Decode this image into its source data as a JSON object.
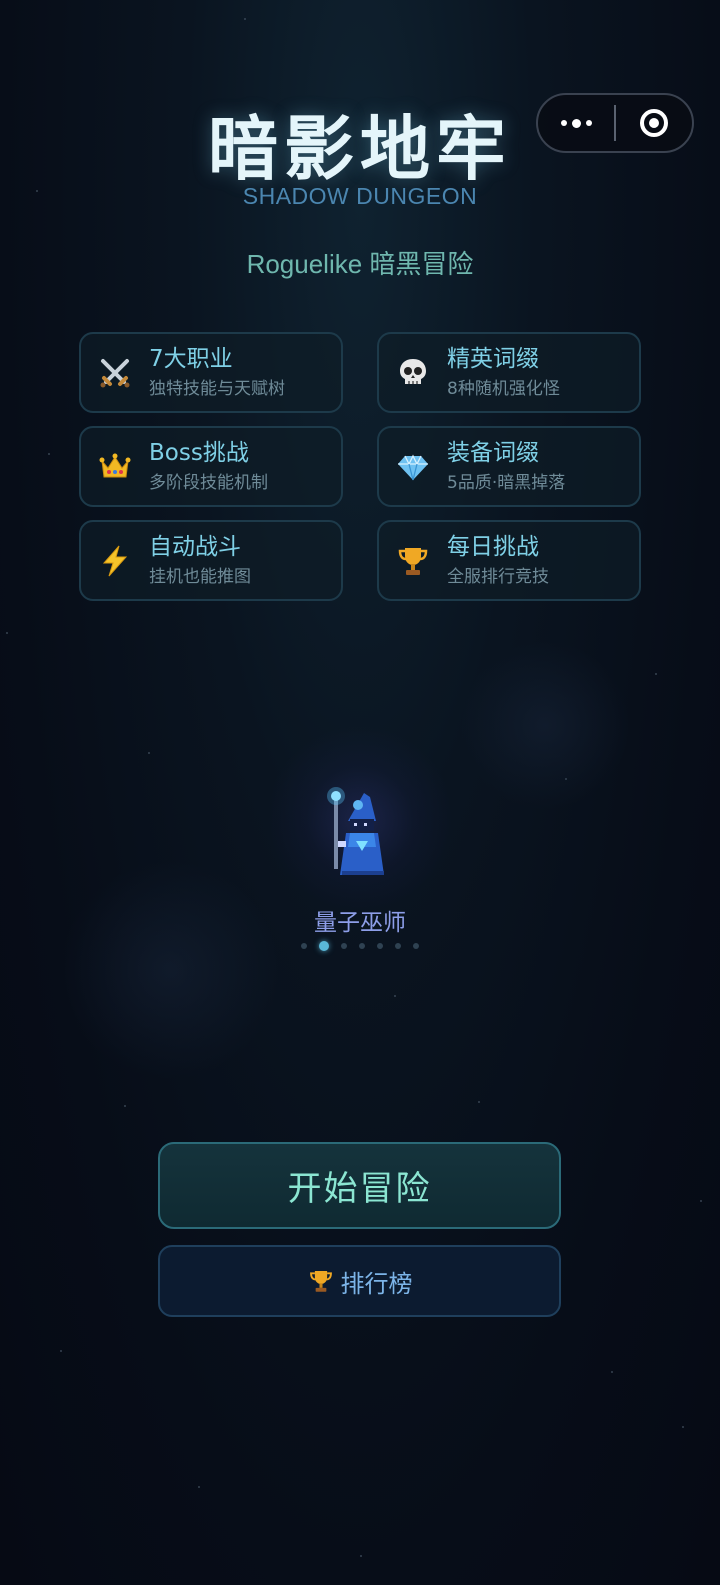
{
  "capsule": {
    "more_icon": "more-dots-icon",
    "close_icon": "target-close-icon"
  },
  "header": {
    "title": "暗影地牢",
    "subtitle_en": "SHADOW DUNGEON",
    "tagline": "Roguelike 暗黑冒险"
  },
  "features": [
    {
      "icon": "crossed-swords-icon",
      "name": "7大职业",
      "desc": "独特技能与天赋树"
    },
    {
      "icon": "skull-icon",
      "name": "精英词缀",
      "desc": "8种随机强化怪"
    },
    {
      "icon": "crown-icon",
      "name": "Boss挑战",
      "desc": "多阶段技能机制"
    },
    {
      "icon": "gem-icon",
      "name": "装备词缀",
      "desc": "5品质·暗黑掉落"
    },
    {
      "icon": "lightning-icon",
      "name": "自动战斗",
      "desc": "挂机也能推图"
    },
    {
      "icon": "trophy-icon",
      "name": "每日挑战",
      "desc": "全服排行竞技"
    }
  ],
  "character": {
    "name": "量子巫师",
    "sprite_icon": "wizard-sprite",
    "page_count": 7,
    "active_index": 1
  },
  "buttons": {
    "start_label": "开始冒险",
    "rank_label": "排行榜",
    "rank_icon": "trophy-icon"
  },
  "colors": {
    "title": "#e4f5fa",
    "feature_name": "#7fd0e6",
    "start_text": "#8be6d2",
    "rank_text": "#7cb4e8",
    "char_name": "#8d9ee8"
  }
}
